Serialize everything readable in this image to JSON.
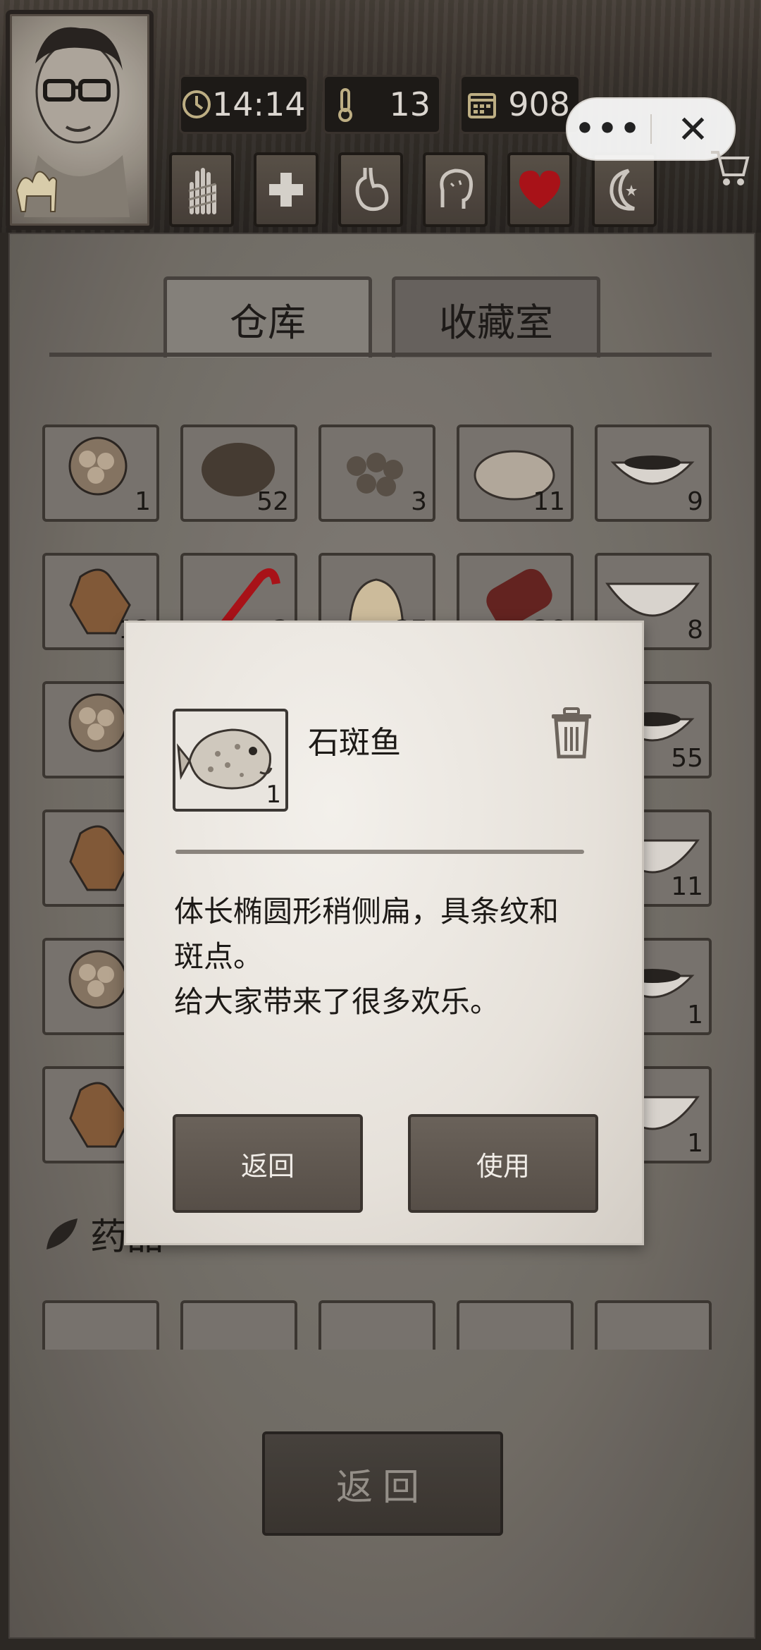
{
  "hud": {
    "time": "14:14",
    "temperature": "13",
    "day": "908",
    "icons": [
      "clock-icon",
      "thermometer-icon",
      "calendar-icon"
    ],
    "status_icons": [
      "hand-bandage-icon",
      "medical-cross-icon",
      "stomach-icon",
      "brain-icon",
      "heart-icon",
      "moon-icon"
    ],
    "heart_color": "#b3141a"
  },
  "capsule": {
    "more": "•••",
    "close": "✕"
  },
  "tabs": {
    "storage": "仓库",
    "collection": "收藏室"
  },
  "inventory": {
    "counts": [
      "1",
      "52",
      "3",
      "11",
      "9",
      "13",
      "3",
      "37",
      "36",
      "8",
      "",
      "",
      "",
      "",
      "55",
      "",
      "",
      "",
      "",
      "11",
      "",
      "",
      "",
      "",
      "1",
      "",
      "",
      "",
      "",
      "1"
    ]
  },
  "section": {
    "label": "药品"
  },
  "bottom": {
    "back": "返回"
  },
  "modal": {
    "item_count": "1",
    "item_name": "石斑鱼",
    "desc_line1": "体长椭圆形稍侧扁，具条纹和",
    "desc_line2": "斑点。",
    "desc_line3": "给大家带来了很多欢乐。",
    "back_label": "返回",
    "use_label": "使用"
  }
}
